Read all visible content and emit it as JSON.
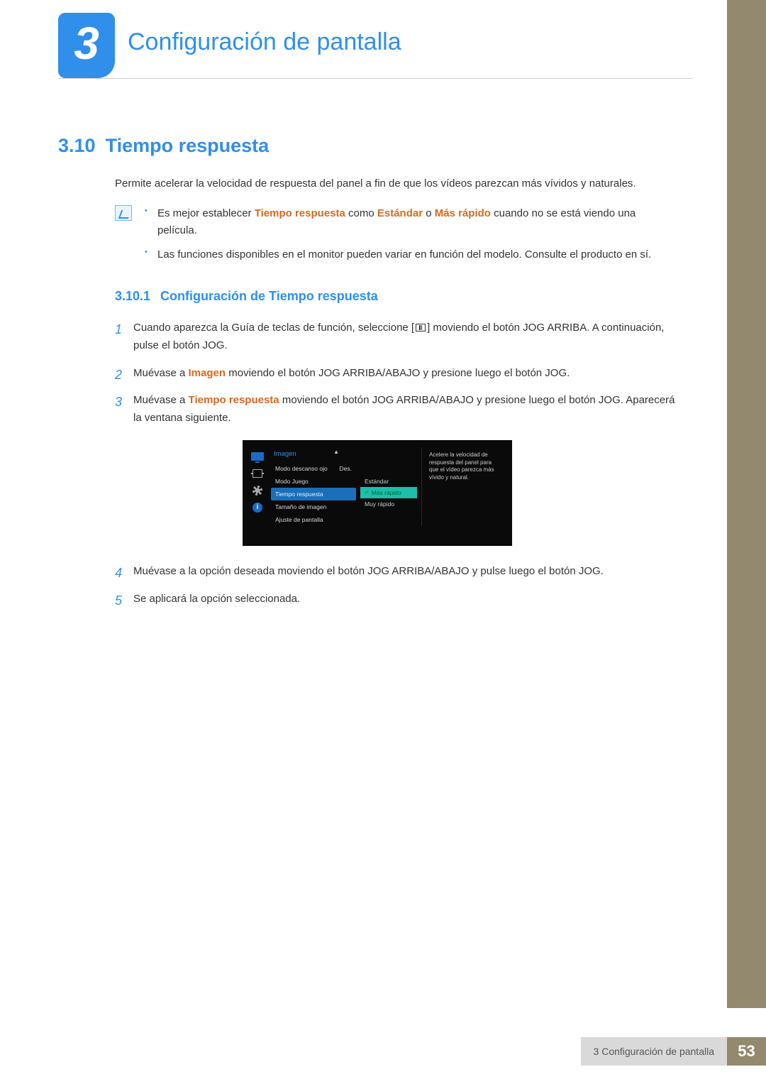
{
  "chapter": {
    "number": "3",
    "title": "Configuración de pantalla"
  },
  "section": {
    "number": "3.10",
    "title": "Tiempo respuesta"
  },
  "intro": "Permite acelerar la velocidad de respuesta del panel a fin de que los vídeos parezcan más vívidos y naturales.",
  "notes": {
    "item1": {
      "pre": "Es mejor establecer ",
      "hl1": "Tiempo respuesta",
      "mid1": " como ",
      "hl2": "Estándar",
      "mid2": " o ",
      "hl3": "Más rápido",
      "post": " cuando no se está viendo una película."
    },
    "item2": "Las funciones disponibles en el monitor pueden variar en función del modelo. Consulte el producto en sí."
  },
  "subsection": {
    "number": "3.10.1",
    "title": "Configuración de Tiempo respuesta"
  },
  "steps": {
    "s1": {
      "pre": "Cuando aparezca la Guía de teclas de función, seleccione [",
      "post": "] moviendo el botón JOG ARRIBA. A continuación, pulse el botón JOG."
    },
    "s2": {
      "pre": "Muévase a ",
      "hl": "Imagen",
      "post": " moviendo el botón JOG ARRIBA/ABAJO y presione luego el botón JOG."
    },
    "s3": {
      "pre": "Muévase a ",
      "hl": "Tiempo respuesta",
      "post": " moviendo el botón JOG ARRIBA/ABAJO y presione luego el botón JOG. Aparecerá la ventana siguiente."
    },
    "s4": "Muévase a la opción deseada moviendo el botón JOG ARRIBA/ABAJO y pulse luego el botón JOG.",
    "s5": "Se aplicará la opción seleccionada."
  },
  "osd": {
    "header": "Imagen",
    "menu": [
      {
        "label": "Modo descanso ojo",
        "value": "Des."
      },
      {
        "label": "Modo Juego",
        "value": ""
      },
      {
        "label": "Tiempo respuesta",
        "value": "",
        "selected": true
      },
      {
        "label": "Tamaño de imagen",
        "value": ""
      },
      {
        "label": "Ajuste de pantalla",
        "value": ""
      }
    ],
    "submenu": [
      {
        "label": "Estándar"
      },
      {
        "label": "Más rápido",
        "selected": true
      },
      {
        "label": "Muy rápido"
      }
    ],
    "desc": "Acelere la velocidad de respuesta del panel para que el vídeo parezca más vívido y natural."
  },
  "footer": {
    "label": "3 Configuración de pantalla",
    "page": "53"
  }
}
